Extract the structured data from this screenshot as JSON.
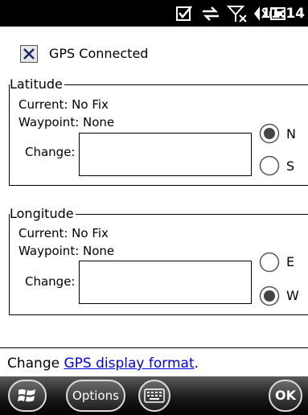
{
  "status_bar": {
    "time": "11:14",
    "icons": [
      "checkbox-icon",
      "sync-icon",
      "no-signal-icon",
      "speaker-icon",
      "battery-icon"
    ]
  },
  "gps": {
    "connected_label": "GPS Connected",
    "connected_checked": true
  },
  "latitude": {
    "legend": "Latitude",
    "current": "Current: No Fix",
    "waypoint": "Waypoint: None",
    "change_label": "Change:",
    "change_value": "",
    "options": [
      {
        "label": "N",
        "selected": true
      },
      {
        "label": "S",
        "selected": false
      }
    ]
  },
  "longitude": {
    "legend": "Longitude",
    "current": "Current: No Fix",
    "waypoint": "Waypoint: None",
    "change_label": "Change:",
    "change_value": "",
    "options": [
      {
        "label": "E",
        "selected": false
      },
      {
        "label": "W",
        "selected": true
      }
    ]
  },
  "footer": {
    "prefix": "Change ",
    "link": "GPS display format",
    "suffix": "."
  },
  "softkeys": {
    "options_label": "Options",
    "ok_label": "OK",
    "start_icon": "windows-start-icon",
    "keyboard_icon": "keyboard-icon"
  }
}
